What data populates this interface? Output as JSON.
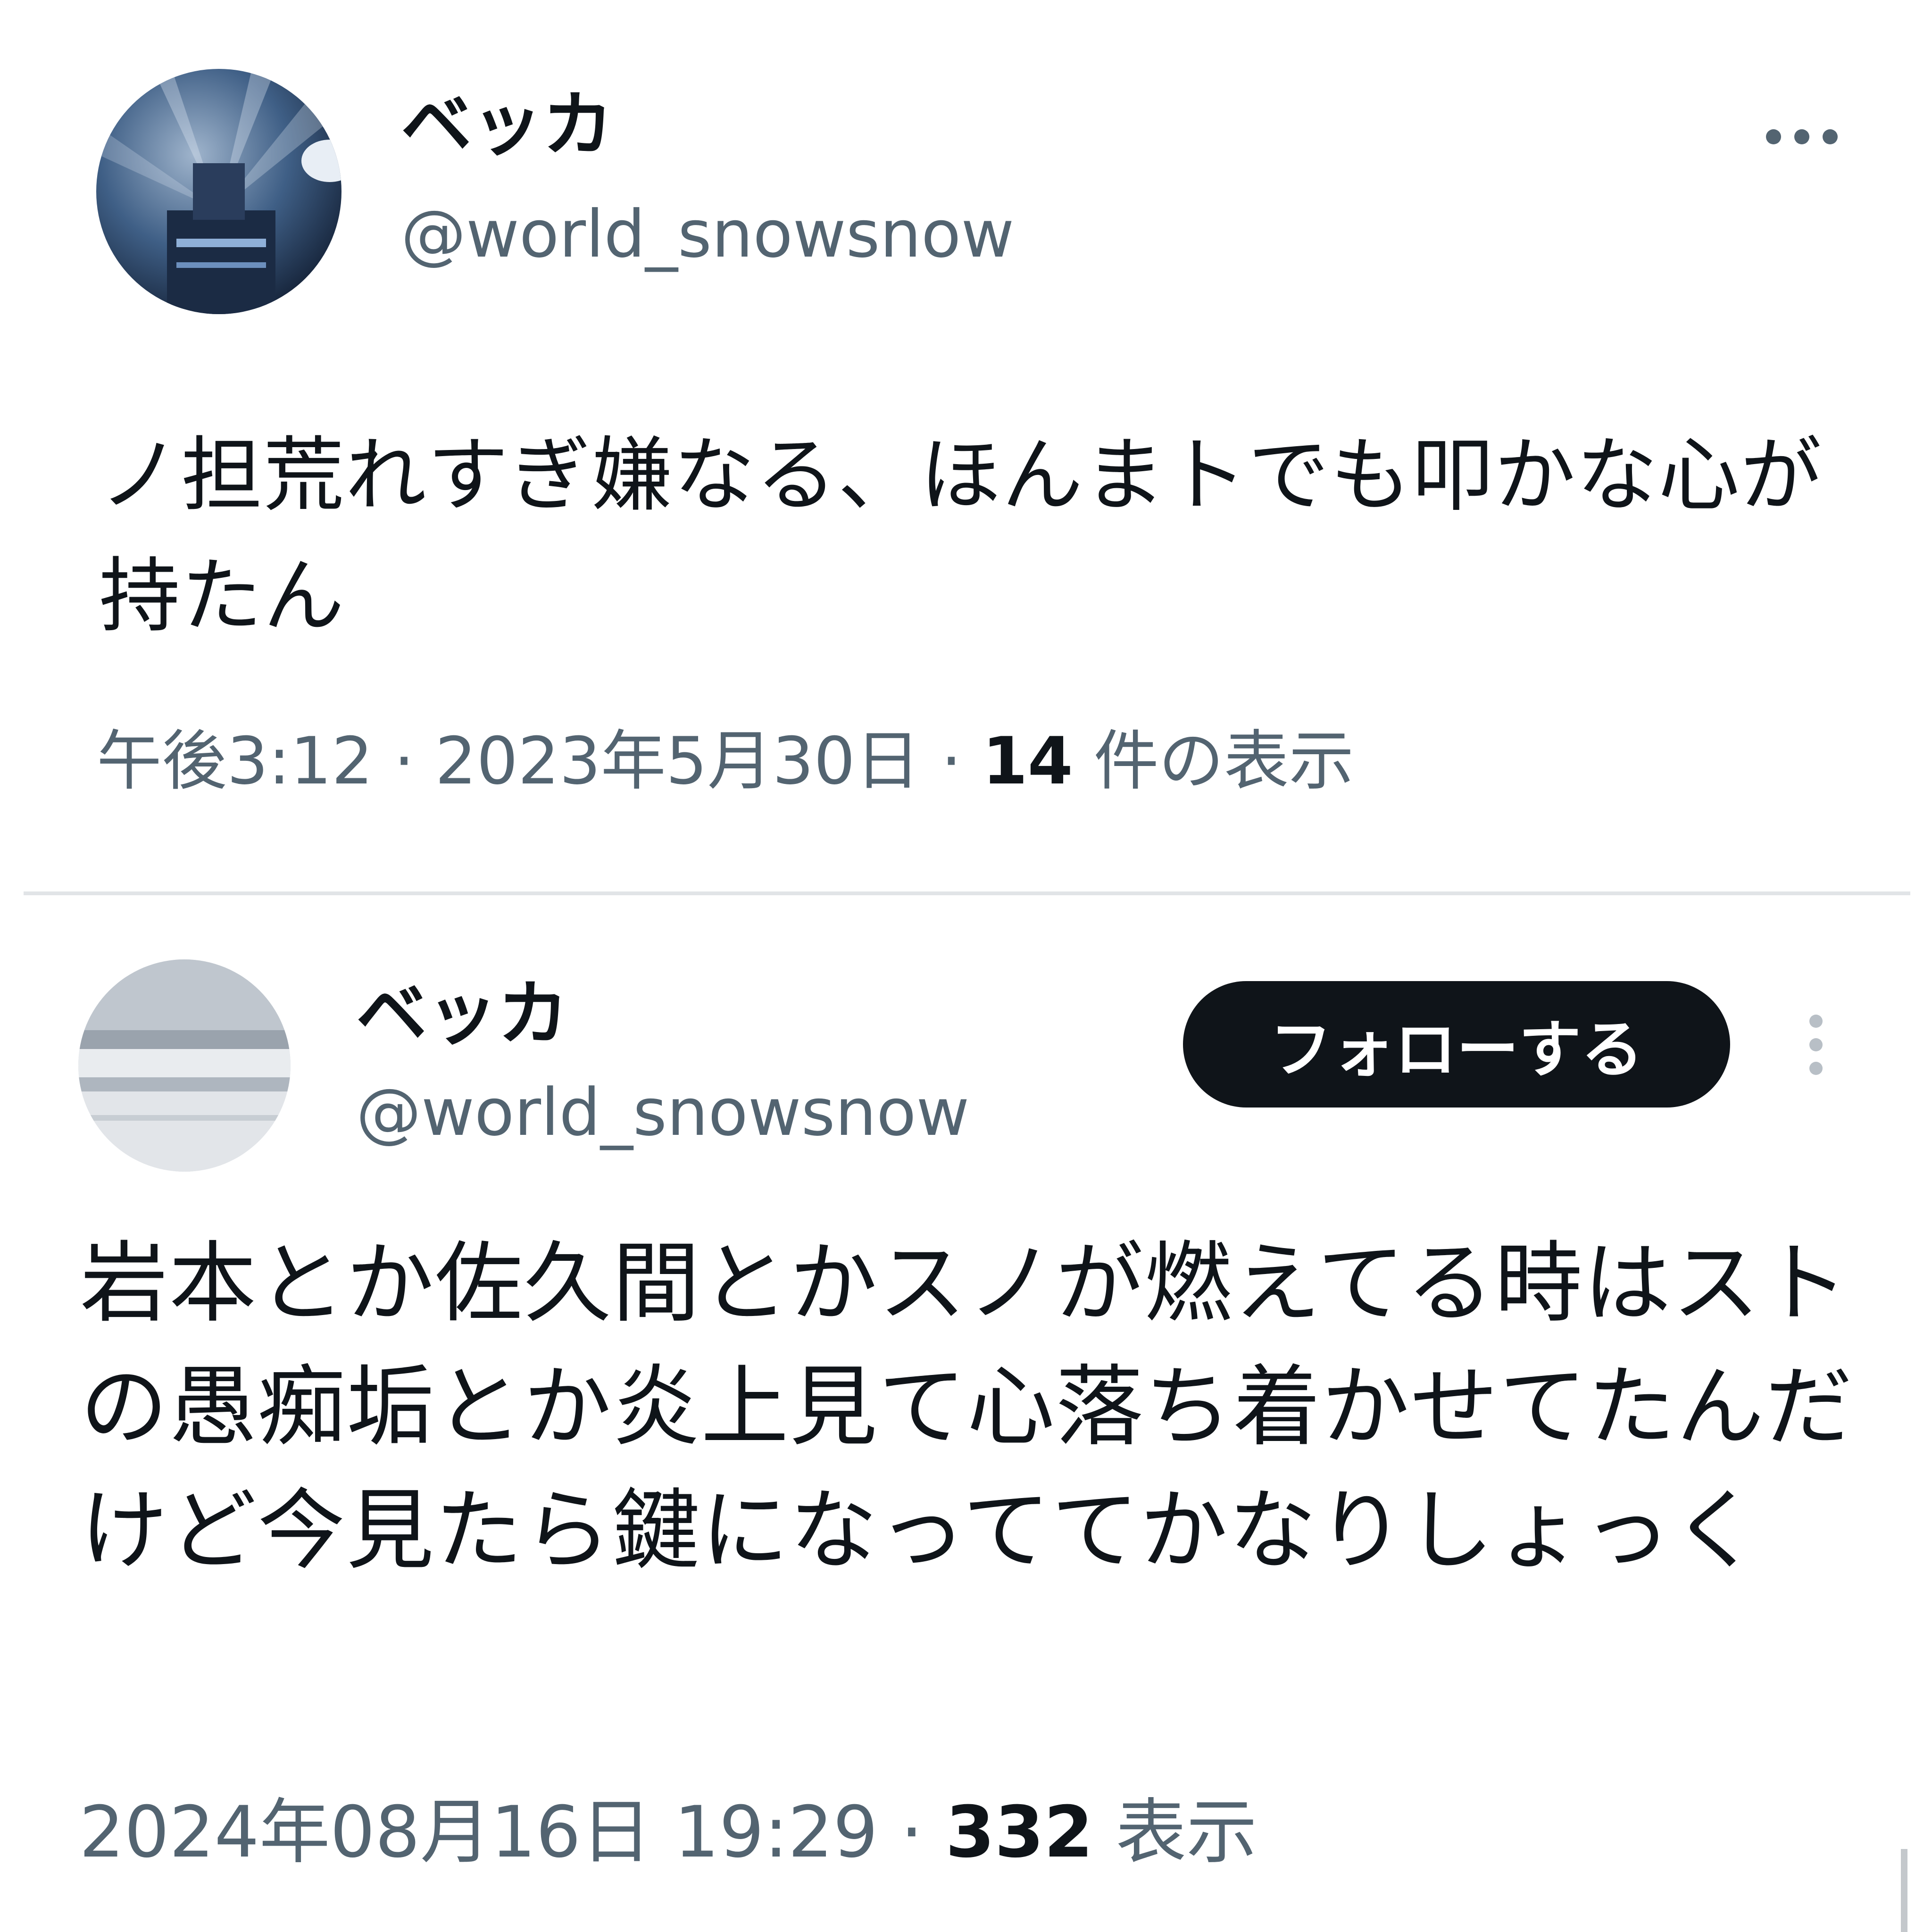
{
  "tweets": [
    {
      "user": {
        "name": "ベッカ",
        "handle": "@world_snowsnow",
        "avatar": "avatar-stadium-image"
      },
      "more_icon": "more-horizontal-icon",
      "text": "ノ担荒れすぎ嫌なる、ほんまトでも叩かな心が持たん",
      "meta": {
        "time_date": "午後3:12 · 2023年5月30日 · ",
        "views_count": "14",
        "views_label": " 件の表示"
      }
    },
    {
      "user": {
        "name": "ベッカ",
        "handle": "@world_snowsnow",
        "avatar": "avatar-snow-sea-image"
      },
      "follow_label": "フォローする",
      "more_icon": "more-vertical-icon",
      "text": "岩本とか佐久間とかスノが燃えてる時はストの愚痴垢とか炎上見て心落ち着かせてたんだけど今見たら鍵になっててかなりしょっく",
      "meta": {
        "time_date": "2024年08月16日 19:29 · ",
        "views_count": "332",
        "views_label": " 表示"
      }
    }
  ],
  "colors": {
    "text": "#0f1419",
    "secondary": "#536471",
    "divider": "#e1e4e7",
    "button_bg": "#0f1419"
  }
}
